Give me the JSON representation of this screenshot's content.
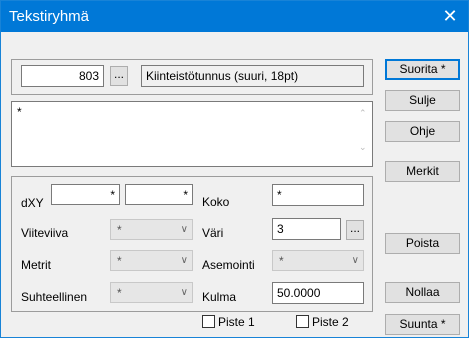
{
  "window": {
    "title": "Tekstiryhmä",
    "close_glyph": "✕"
  },
  "top": {
    "number": "803",
    "browse": "...",
    "type_label": "Kiinteistötunnus (suuri, 18pt)"
  },
  "text": {
    "value": "*",
    "up": "⌃",
    "down": "⌄"
  },
  "params": {
    "dxy_label": "dXY",
    "dx_value": "*",
    "dy_value": "*",
    "koko_label": "Koko",
    "koko_value": "*",
    "viiteviiva_label": "Viiteviiva",
    "viiteviiva_value": "*",
    "vari_label": "Väri",
    "vari_value": "3",
    "vari_browse": "...",
    "metrit_label": "Metrit",
    "metrit_value": "*",
    "asemointi_label": "Asemointi",
    "asemointi_value": "*",
    "suhteellinen_label": "Suhteellinen",
    "suhteellinen_value": "*",
    "kulma_label": "Kulma",
    "kulma_value": "50.0000",
    "piste1_label": "Piste 1",
    "piste2_label": "Piste 2"
  },
  "buttons": {
    "suorita": "Suorita *",
    "sulje": "Sulje",
    "ohje": "Ohje",
    "merkit": "Merkit",
    "poista": "Poista",
    "nollaa": "Nollaa",
    "suunta": "Suunta *"
  },
  "icons": {
    "dropdown": "chevron-down-icon",
    "close": "close-icon"
  }
}
